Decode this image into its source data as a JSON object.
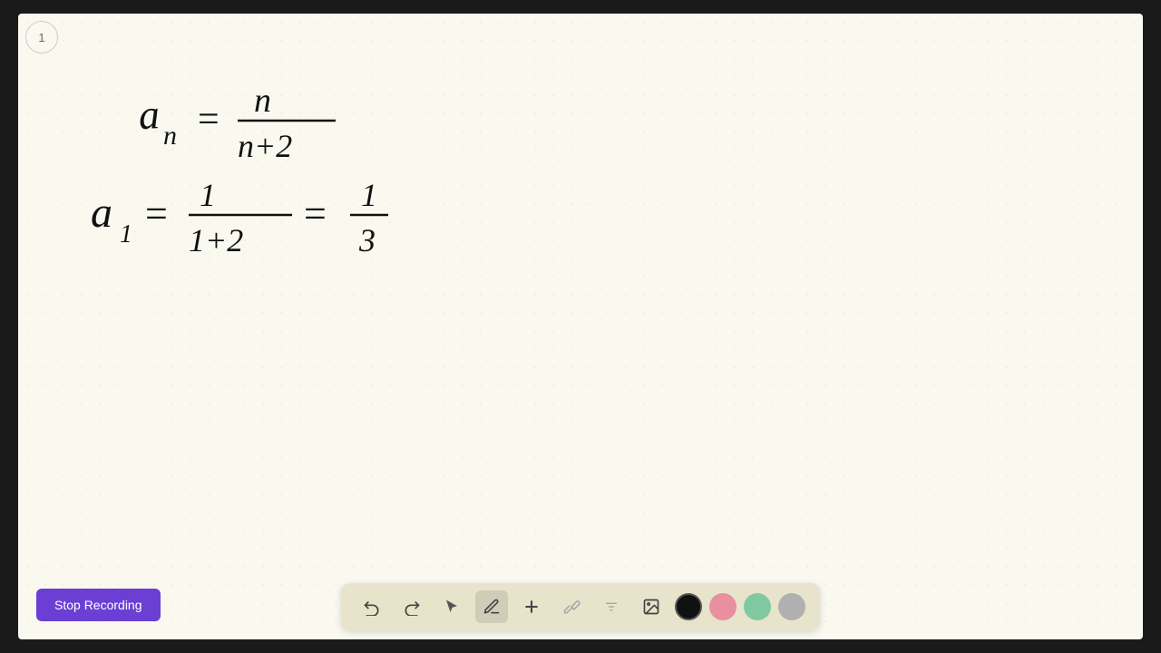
{
  "canvas": {
    "background": "#faf9f0"
  },
  "page_indicator": {
    "number": "1"
  },
  "stop_recording_button": {
    "label": "Stop Recording"
  },
  "toolbar": {
    "undo_label": "↩",
    "redo_label": "↪",
    "select_label": "▷",
    "pen_label": "✏",
    "add_label": "+",
    "highlighter_label": "⌇",
    "text_label": "A",
    "image_label": "▣",
    "colors": [
      {
        "name": "black",
        "hex": "#111111",
        "selected": true
      },
      {
        "name": "pink",
        "hex": "#e88fa0",
        "selected": false
      },
      {
        "name": "green",
        "hex": "#80c9a0",
        "selected": false
      },
      {
        "name": "gray",
        "hex": "#b0b0b0",
        "selected": false
      }
    ]
  }
}
